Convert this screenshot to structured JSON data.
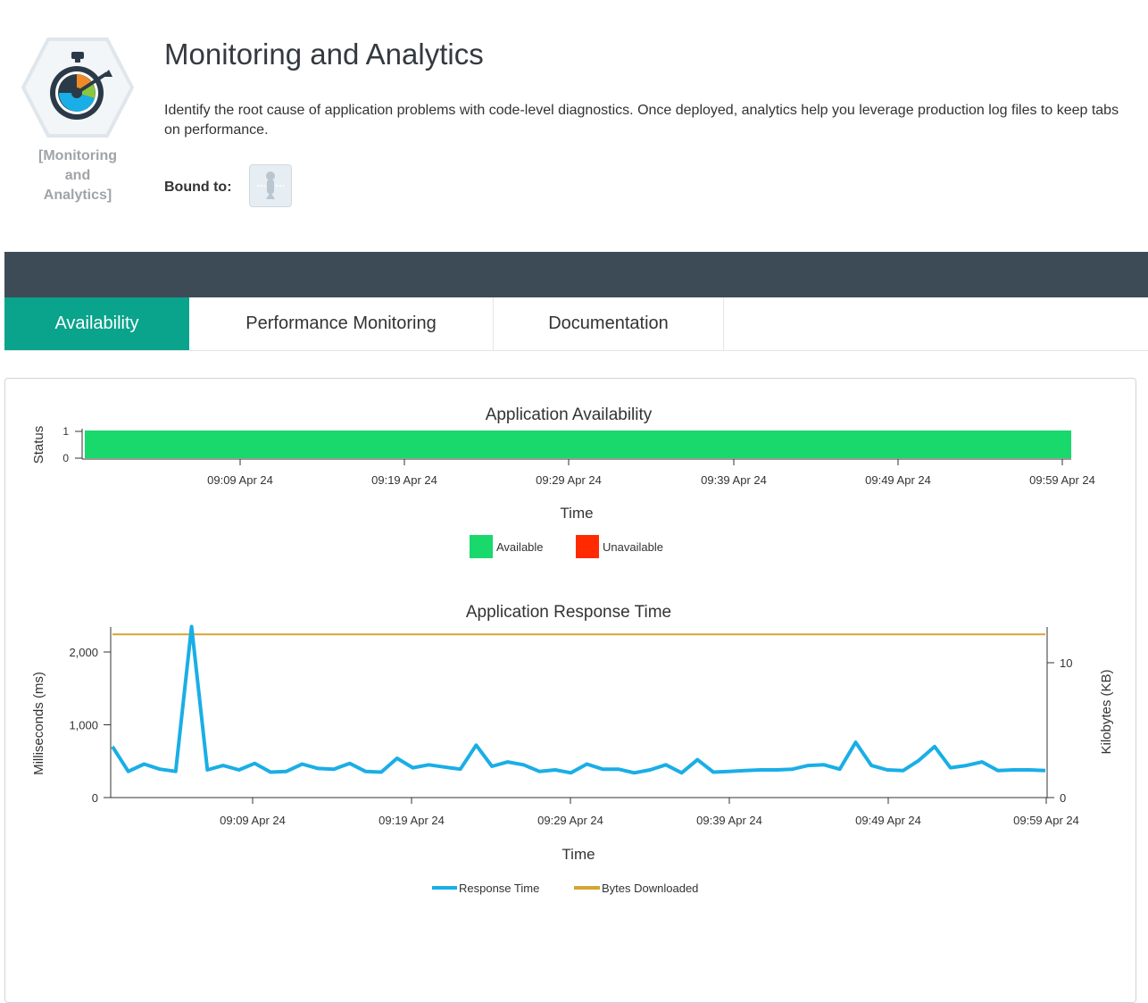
{
  "header": {
    "title": "Monitoring and Analytics",
    "description": "Identify the root cause of application problems with code-level diagnostics. Once deployed, analytics help you leverage production log files to keep tabs on performance.",
    "logo_caption": [
      "[Monitoring",
      "and",
      "Analytics]"
    ],
    "bound_label": "Bound to:",
    "bound_icon": "app-service-icon"
  },
  "tabs": [
    {
      "label": "Availability",
      "active": true
    },
    {
      "label": "Performance Monitoring",
      "active": false
    },
    {
      "label": "Documentation",
      "active": false
    }
  ],
  "colors": {
    "accent": "#0aa38c",
    "dark_bar": "#3d4b56",
    "available": "#19d86c",
    "unavailable": "#ff2a00",
    "response_time": "#1aaee6",
    "bytes_downloaded": "#d4a532"
  },
  "chart_data": [
    {
      "type": "bar",
      "title": "Application Availability",
      "xlabel": "Time",
      "ylabel": "Status",
      "x_ticks": [
        "09:09 Apr 24",
        "09:19 Apr 24",
        "09:29 Apr 24",
        "09:39 Apr 24",
        "09:49 Apr 24",
        "09:59 Apr 24"
      ],
      "y_ticks": [
        "1",
        "0"
      ],
      "ylim": [
        0,
        1
      ],
      "series": [
        {
          "name": "Available",
          "value": 1,
          "color": "#19d86c"
        },
        {
          "name": "Unavailable",
          "value": 0,
          "color": "#ff2a00"
        }
      ],
      "legend": [
        "Available",
        "Unavailable"
      ],
      "legend_position": "bottom"
    },
    {
      "type": "line",
      "title": "Application Response Time",
      "xlabel": "Time",
      "ylabel": "Milliseconds (ms)",
      "y2label": "Kilobytes (KB)",
      "x_ticks": [
        "09:09 Apr 24",
        "09:19 Apr 24",
        "09:29 Apr 24",
        "09:39 Apr 24",
        "09:49 Apr 24",
        "09:59 Apr 24"
      ],
      "y_ticks": [
        "2,000",
        "1,000",
        "0"
      ],
      "y2_ticks": [
        "10",
        "0"
      ],
      "ylim": [
        0,
        2400
      ],
      "y2lim": [
        0,
        12
      ],
      "series": [
        {
          "name": "Response Time",
          "axis": "left",
          "color": "#1aaee6",
          "values": [
            700,
            360,
            460,
            390,
            360,
            2350,
            380,
            440,
            380,
            470,
            350,
            360,
            460,
            400,
            390,
            470,
            360,
            350,
            540,
            410,
            450,
            420,
            390,
            720,
            430,
            490,
            450,
            360,
            380,
            340,
            460,
            390,
            390,
            340,
            380,
            450,
            340,
            520,
            350,
            360,
            370,
            380,
            380,
            390,
            440,
            450,
            390,
            760,
            440,
            380,
            370,
            510,
            700,
            410,
            440,
            490,
            370,
            380,
            380,
            370
          ]
        },
        {
          "name": "Bytes Downloaded",
          "axis": "right",
          "color": "#d4a532",
          "values": [
            12.1,
            12.1,
            12.1,
            12.1,
            12.1,
            12.1,
            12.1,
            12.1,
            12.1,
            12.1,
            12.1,
            12.1,
            12.1,
            12.1,
            12.1,
            12.1,
            12.1,
            12.1,
            12.1,
            12.1,
            12.1,
            12.1,
            12.1,
            12.1,
            12.1,
            12.1,
            12.1,
            12.1,
            12.1,
            12.1,
            12.1,
            12.1,
            12.1,
            12.1,
            12.1,
            12.1,
            12.1,
            12.1,
            12.1,
            12.1,
            12.1,
            12.1,
            12.1,
            12.1,
            12.1,
            12.1,
            12.1,
            12.1,
            12.1,
            12.1,
            12.1,
            12.1,
            12.1,
            12.1,
            12.1,
            12.1,
            12.1,
            12.1,
            12.1,
            12.1
          ]
        }
      ],
      "legend": [
        "Response Time",
        "Bytes Downloaded"
      ],
      "legend_position": "bottom"
    }
  ]
}
